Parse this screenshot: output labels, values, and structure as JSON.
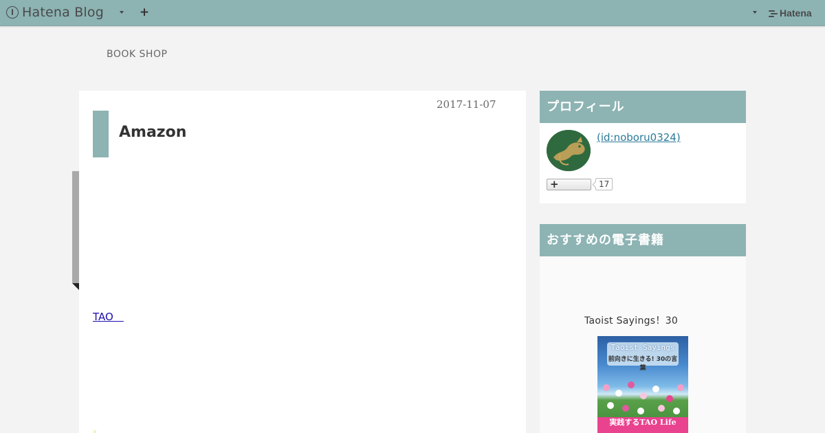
{
  "topbar": {
    "logo_text": "Hatena Blog",
    "plus_symbol": "+",
    "brand_text": "Hatena",
    "icons": [
      "hatena-logo-icon",
      "chevron-down-icon",
      "plus-icon",
      "hatena-brand-icon"
    ]
  },
  "blog": {
    "title": "BOOK SHOP"
  },
  "entry": {
    "date": "2017-11-07",
    "title": "Amazon",
    "link_text": "TAO　"
  },
  "sidebar": {
    "profile": {
      "heading": "プロフィール",
      "id_text": " (id:noboru0324)",
      "subscribe_symbol": "+",
      "subscriber_count": "17"
    },
    "book": {
      "heading": "おすすめの電子書籍",
      "title": "Taoist Sayings！30",
      "cover_title": "Taoist Sayings",
      "cover_subtitle": "前向きに生きる! 30の言葉",
      "cover_bottom": "実践するTAO Life"
    }
  },
  "colors": {
    "accent": "#8db3b3",
    "background": "#f3f3f3",
    "link": "#1a0dab",
    "profile_link": "#2a7a9a"
  }
}
